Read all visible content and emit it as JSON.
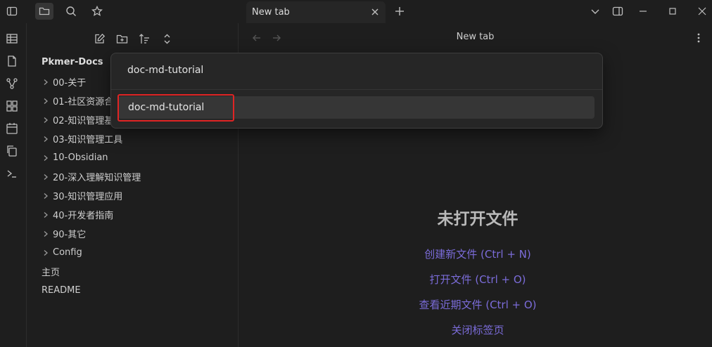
{
  "tab": {
    "title": "New tab"
  },
  "view": {
    "title": "New tab"
  },
  "sidebar": {
    "vault_name": "Pkmer-Docs",
    "folders": [
      {
        "label": "00-关于"
      },
      {
        "label": "01-社区资源合"
      },
      {
        "label": "02-知识管理基"
      },
      {
        "label": "03-知识管理工具"
      },
      {
        "label": "10-Obsidian"
      },
      {
        "label": "20-深入理解知识管理"
      },
      {
        "label": "30-知识管理应用"
      },
      {
        "label": "40-开发者指南"
      },
      {
        "label": "90-其它"
      },
      {
        "label": "Config"
      }
    ],
    "files": [
      {
        "label": "主页"
      },
      {
        "label": "README"
      }
    ]
  },
  "empty_state": {
    "title": "未打开文件",
    "actions": [
      "创建新文件 (Ctrl + N)",
      "打开文件 (Ctrl + O)",
      "查看近期文件 (Ctrl + O)",
      "关闭标签页"
    ]
  },
  "quick_switcher": {
    "input_value": "doc-md-tutorial",
    "suggestions": [
      "doc-md-tutorial"
    ]
  },
  "colors": {
    "background": "#1e1e1e",
    "accent": "#7b6cd9",
    "highlight_box": "#e02424"
  },
  "icons": {
    "titlebar": [
      "sidebar-toggle-icon",
      "folder-icon",
      "search-icon",
      "star-icon"
    ],
    "ribbon": [
      "table-icon",
      "file-icon",
      "graph-icon",
      "grid-icon",
      "calendar-icon",
      "copy-icon",
      "terminal-icon"
    ],
    "file_explorer": [
      "new-note-icon",
      "new-folder-icon",
      "sort-icon",
      "collapse-icon"
    ]
  }
}
